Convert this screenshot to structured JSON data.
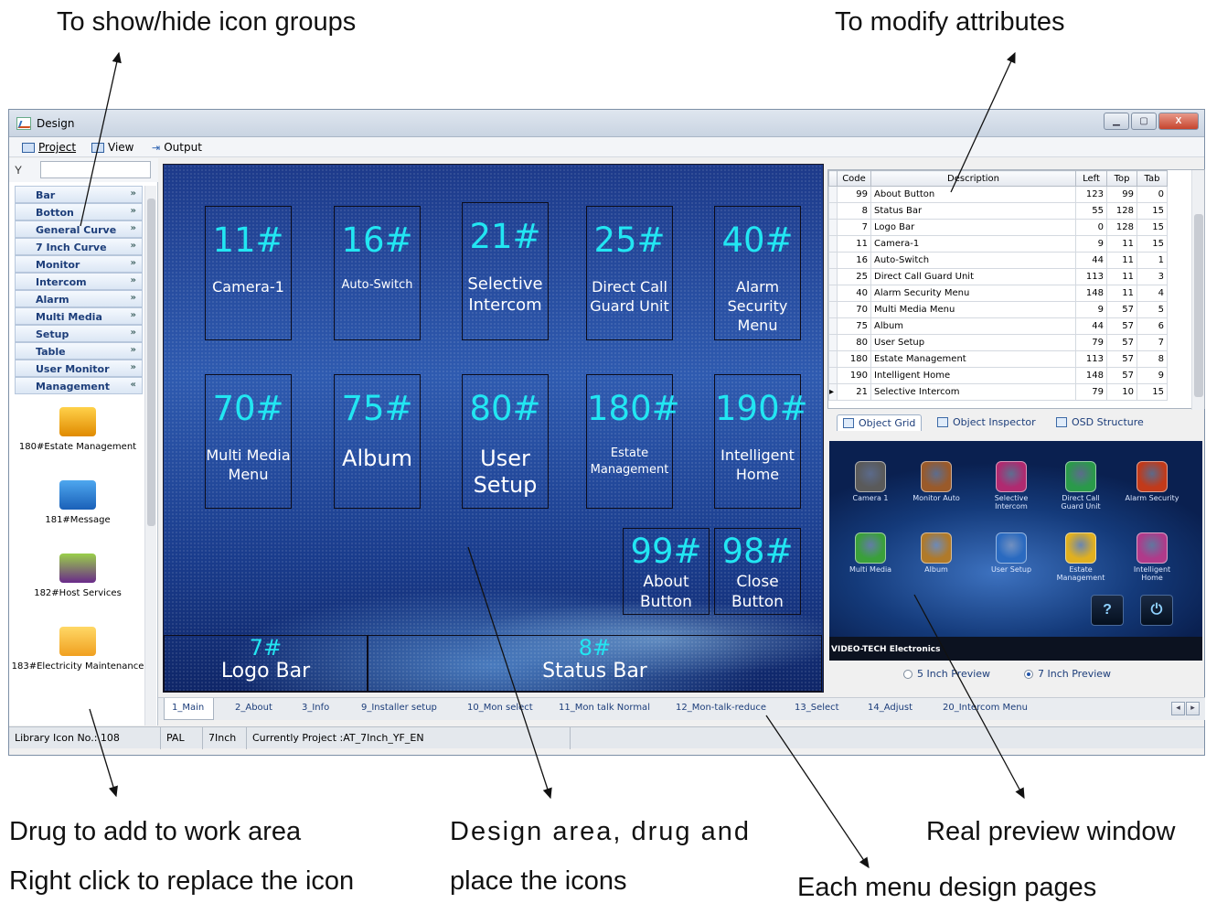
{
  "annotations": {
    "show_hide": "To show/hide icon groups",
    "modify_attrs": "To modify attributes",
    "drug_add": "Drug to add to work area",
    "right_click": "Right click to replace the icon",
    "design_area_1": "Design  area,  drug  and",
    "design_area_2": "place the icons",
    "real_preview": "Real preview window",
    "menu_pages": "Each menu design pages"
  },
  "window": {
    "title": "Design",
    "buttons": {
      "minimize": "▁",
      "maximize": "▢",
      "close": "X"
    }
  },
  "menubar": {
    "project": "Project",
    "view": "View",
    "output": "Output"
  },
  "sidebar": {
    "filter_icon": "Y",
    "groups": [
      {
        "label": "Bar",
        "chevron": "»"
      },
      {
        "label": "Botton",
        "chevron": "»"
      },
      {
        "label": "General Curve",
        "chevron": "»"
      },
      {
        "label": "7 Inch Curve",
        "chevron": "»"
      },
      {
        "label": "Monitor",
        "chevron": "»"
      },
      {
        "label": "Intercom",
        "chevron": "»"
      },
      {
        "label": "Alarm",
        "chevron": "»"
      },
      {
        "label": "Multi Media",
        "chevron": "»"
      },
      {
        "label": "Setup",
        "chevron": "»"
      },
      {
        "label": "Table",
        "chevron": "»"
      },
      {
        "label": "User Monitor",
        "chevron": "»"
      },
      {
        "label": "Management",
        "chevron": "«"
      }
    ],
    "items": [
      {
        "label": "180#Estate Management",
        "icon": "estate-manager-icon"
      },
      {
        "label": "181#Message",
        "icon": "envelope-icon"
      },
      {
        "label": "182#Host Services",
        "icon": "host-services-icon"
      },
      {
        "label": "183#Electricity Maintenance",
        "icon": "electricity-icon"
      }
    ]
  },
  "design": {
    "tiles": [
      {
        "code": "11#",
        "name": "Camera-1"
      },
      {
        "code": "16#",
        "name": "Auto-Switch"
      },
      {
        "code": "21#",
        "name": "Selective Intercom"
      },
      {
        "code": "25#",
        "name": "Direct Call Guard Unit"
      },
      {
        "code": "40#",
        "name": "Alarm Security Menu"
      },
      {
        "code": "70#",
        "name": "Multi Media Menu"
      },
      {
        "code": "75#",
        "name": "Album"
      },
      {
        "code": "80#",
        "name": "User Setup"
      },
      {
        "code": "180#",
        "name": "Estate Management"
      },
      {
        "code": "190#",
        "name": "Intelligent Home"
      },
      {
        "code": "99#",
        "name": "About Button"
      },
      {
        "code": "98#",
        "name": "Close Button"
      }
    ],
    "bars": [
      {
        "code": "7#",
        "name": "Logo Bar"
      },
      {
        "code": "8#",
        "name": "Status Bar"
      }
    ]
  },
  "object_grid": {
    "columns": [
      "Code",
      "Description",
      "Left",
      "Top",
      "Tab"
    ],
    "rows": [
      [
        "99",
        "About Button",
        "123",
        "99",
        "0"
      ],
      [
        "8",
        "Status Bar",
        "55",
        "128",
        "15"
      ],
      [
        "7",
        "Logo Bar",
        "0",
        "128",
        "15"
      ],
      [
        "11",
        "Camera-1",
        "9",
        "11",
        "15"
      ],
      [
        "16",
        "Auto-Switch",
        "44",
        "11",
        "1"
      ],
      [
        "25",
        "Direct Call Guard Unit",
        "113",
        "11",
        "3"
      ],
      [
        "40",
        "Alarm Security Menu",
        "148",
        "11",
        "4"
      ],
      [
        "70",
        "Multi Media Menu",
        "9",
        "57",
        "5"
      ],
      [
        "75",
        "Album",
        "44",
        "57",
        "6"
      ],
      [
        "80",
        "User Setup",
        "79",
        "57",
        "7"
      ],
      [
        "180",
        "Estate Management",
        "113",
        "57",
        "8"
      ],
      [
        "190",
        "Intelligent Home",
        "148",
        "57",
        "9"
      ],
      [
        "21",
        "Selective Intercom",
        "79",
        "10",
        "15"
      ]
    ]
  },
  "right_tabs": [
    "Object Grid",
    "Object Inspector",
    "OSD Structure"
  ],
  "preview": {
    "icons": [
      {
        "label": "Camera 1",
        "color": "#5a5a5a"
      },
      {
        "label": "Monitor Auto",
        "color": "#9a5a2a"
      },
      {
        "label": "Selective Intercom",
        "color": "#b02a70"
      },
      {
        "label": "Direct Call Guard Unit",
        "color": "#2a9a4a"
      },
      {
        "label": "Alarm Security",
        "color": "#c23a1a"
      },
      {
        "label": "Multi Media",
        "color": "#3aa03a"
      },
      {
        "label": "Album",
        "color": "#b07a2a"
      },
      {
        "label": "User Setup",
        "color": "#2a6ac0"
      },
      {
        "label": "Estate Management",
        "color": "#e0b020"
      },
      {
        "label": "Intelligent Home",
        "color": "#b03a8a"
      }
    ],
    "help_btn": "?",
    "power_btn": "⏻",
    "bar_text": "VIDEO-TECH Electronics",
    "radio_5": "5 Inch Preview",
    "radio_7": "7 Inch Preview"
  },
  "page_tabs": [
    "1_Main",
    "2_About",
    "3_Info",
    "9_Installer setup",
    "10_Mon select",
    "11_Mon talk Normal",
    "12_Mon-talk-reduce",
    "13_Select",
    "14_Adjust",
    "20_Intercom Menu"
  ],
  "status": {
    "library": "Library Icon No.: 108",
    "format": "PAL",
    "size": "7Inch",
    "project": "Currently Project :AT_7Inch_YF_EN"
  }
}
